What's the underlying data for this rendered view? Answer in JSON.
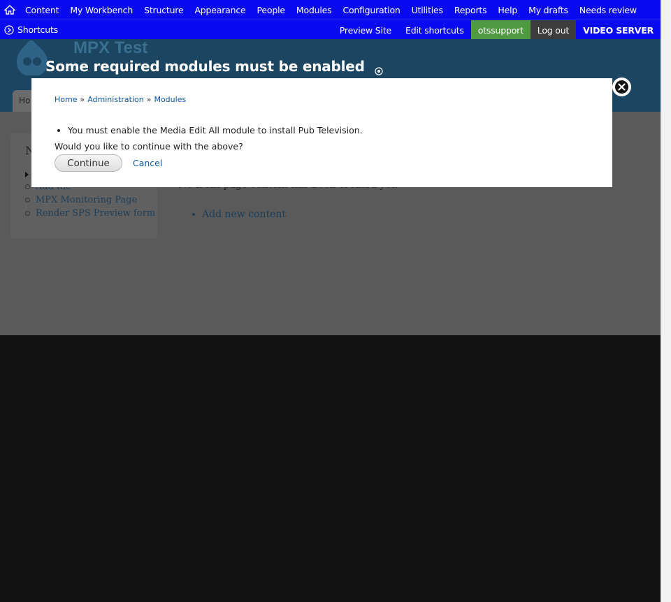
{
  "toolbar": {
    "menu": [
      "Content",
      "My Workbench",
      "Structure",
      "Appearance",
      "People",
      "Modules",
      "Configuration",
      "Utilities",
      "Reports",
      "Help",
      "My drafts",
      "Needs review"
    ],
    "shortcuts_label": "Shortcuts",
    "preview_site": "Preview Site",
    "edit_shortcuts": "Edit shortcuts",
    "username": "otssupport",
    "logout": "Log out",
    "site_label": "VIDEO SERVER"
  },
  "page": {
    "site_name": "MPX Test",
    "tab_label": "Ho",
    "sidebar_title_initial": "N",
    "sidebar_links": [
      "Add file",
      "MPX Monitoring Page",
      "Render SPS Preview form"
    ],
    "main_text": "No front page content has been created yet.",
    "main_link": "Add new content"
  },
  "modal": {
    "title": "Some required modules must be enabled",
    "breadcrumb": {
      "home": "Home",
      "administration": "Administration",
      "modules": "Modules",
      "separator": "»"
    },
    "message": "You must enable the Media Edit All module to install Pub Television.",
    "question": "Would you like to continue with the above?",
    "continue_label": "Continue",
    "cancel_label": "Cancel"
  },
  "colors": {
    "toolbar": "#0a0af0",
    "user_badge": "#4f9a41",
    "logout_badge": "#3d3d3d",
    "link": "#0b57a3",
    "overlay": "#111111"
  },
  "icons": [
    "home-icon",
    "shortcuts-toggle-icon",
    "drupal-logo-icon",
    "close-icon",
    "overlay-expand-icon"
  ]
}
